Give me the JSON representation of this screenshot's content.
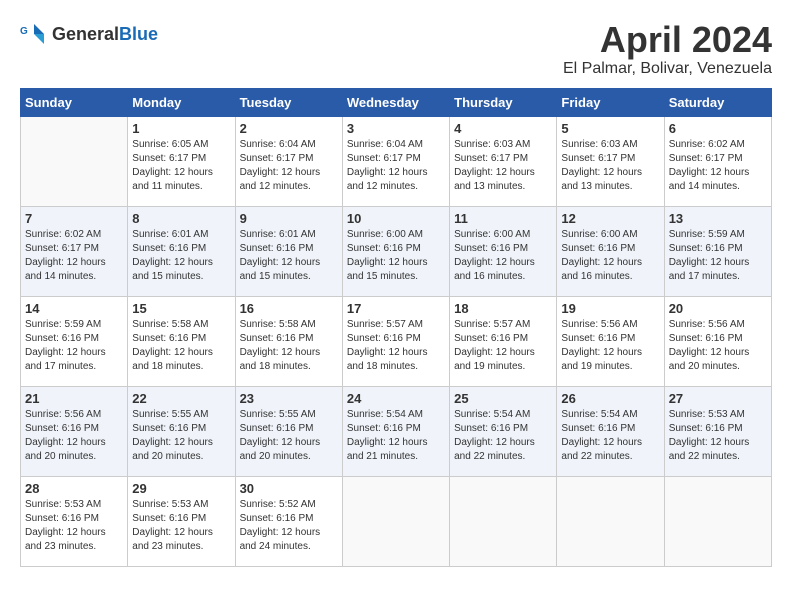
{
  "logo": {
    "general": "General",
    "blue": "Blue"
  },
  "title": "April 2024",
  "subtitle": "El Palmar, Bolivar, Venezuela",
  "headers": [
    "Sunday",
    "Monday",
    "Tuesday",
    "Wednesday",
    "Thursday",
    "Friday",
    "Saturday"
  ],
  "weeks": [
    [
      {
        "day": "",
        "sunrise": "",
        "sunset": "",
        "daylight": ""
      },
      {
        "day": "1",
        "sunrise": "Sunrise: 6:05 AM",
        "sunset": "Sunset: 6:17 PM",
        "daylight": "Daylight: 12 hours and 11 minutes."
      },
      {
        "day": "2",
        "sunrise": "Sunrise: 6:04 AM",
        "sunset": "Sunset: 6:17 PM",
        "daylight": "Daylight: 12 hours and 12 minutes."
      },
      {
        "day": "3",
        "sunrise": "Sunrise: 6:04 AM",
        "sunset": "Sunset: 6:17 PM",
        "daylight": "Daylight: 12 hours and 12 minutes."
      },
      {
        "day": "4",
        "sunrise": "Sunrise: 6:03 AM",
        "sunset": "Sunset: 6:17 PM",
        "daylight": "Daylight: 12 hours and 13 minutes."
      },
      {
        "day": "5",
        "sunrise": "Sunrise: 6:03 AM",
        "sunset": "Sunset: 6:17 PM",
        "daylight": "Daylight: 12 hours and 13 minutes."
      },
      {
        "day": "6",
        "sunrise": "Sunrise: 6:02 AM",
        "sunset": "Sunset: 6:17 PM",
        "daylight": "Daylight: 12 hours and 14 minutes."
      }
    ],
    [
      {
        "day": "7",
        "sunrise": "Sunrise: 6:02 AM",
        "sunset": "Sunset: 6:17 PM",
        "daylight": "Daylight: 12 hours and 14 minutes."
      },
      {
        "day": "8",
        "sunrise": "Sunrise: 6:01 AM",
        "sunset": "Sunset: 6:16 PM",
        "daylight": "Daylight: 12 hours and 15 minutes."
      },
      {
        "day": "9",
        "sunrise": "Sunrise: 6:01 AM",
        "sunset": "Sunset: 6:16 PM",
        "daylight": "Daylight: 12 hours and 15 minutes."
      },
      {
        "day": "10",
        "sunrise": "Sunrise: 6:00 AM",
        "sunset": "Sunset: 6:16 PM",
        "daylight": "Daylight: 12 hours and 15 minutes."
      },
      {
        "day": "11",
        "sunrise": "Sunrise: 6:00 AM",
        "sunset": "Sunset: 6:16 PM",
        "daylight": "Daylight: 12 hours and 16 minutes."
      },
      {
        "day": "12",
        "sunrise": "Sunrise: 6:00 AM",
        "sunset": "Sunset: 6:16 PM",
        "daylight": "Daylight: 12 hours and 16 minutes."
      },
      {
        "day": "13",
        "sunrise": "Sunrise: 5:59 AM",
        "sunset": "Sunset: 6:16 PM",
        "daylight": "Daylight: 12 hours and 17 minutes."
      }
    ],
    [
      {
        "day": "14",
        "sunrise": "Sunrise: 5:59 AM",
        "sunset": "Sunset: 6:16 PM",
        "daylight": "Daylight: 12 hours and 17 minutes."
      },
      {
        "day": "15",
        "sunrise": "Sunrise: 5:58 AM",
        "sunset": "Sunset: 6:16 PM",
        "daylight": "Daylight: 12 hours and 18 minutes."
      },
      {
        "day": "16",
        "sunrise": "Sunrise: 5:58 AM",
        "sunset": "Sunset: 6:16 PM",
        "daylight": "Daylight: 12 hours and 18 minutes."
      },
      {
        "day": "17",
        "sunrise": "Sunrise: 5:57 AM",
        "sunset": "Sunset: 6:16 PM",
        "daylight": "Daylight: 12 hours and 18 minutes."
      },
      {
        "day": "18",
        "sunrise": "Sunrise: 5:57 AM",
        "sunset": "Sunset: 6:16 PM",
        "daylight": "Daylight: 12 hours and 19 minutes."
      },
      {
        "day": "19",
        "sunrise": "Sunrise: 5:56 AM",
        "sunset": "Sunset: 6:16 PM",
        "daylight": "Daylight: 12 hours and 19 minutes."
      },
      {
        "day": "20",
        "sunrise": "Sunrise: 5:56 AM",
        "sunset": "Sunset: 6:16 PM",
        "daylight": "Daylight: 12 hours and 20 minutes."
      }
    ],
    [
      {
        "day": "21",
        "sunrise": "Sunrise: 5:56 AM",
        "sunset": "Sunset: 6:16 PM",
        "daylight": "Daylight: 12 hours and 20 minutes."
      },
      {
        "day": "22",
        "sunrise": "Sunrise: 5:55 AM",
        "sunset": "Sunset: 6:16 PM",
        "daylight": "Daylight: 12 hours and 20 minutes."
      },
      {
        "day": "23",
        "sunrise": "Sunrise: 5:55 AM",
        "sunset": "Sunset: 6:16 PM",
        "daylight": "Daylight: 12 hours and 20 minutes."
      },
      {
        "day": "24",
        "sunrise": "Sunrise: 5:54 AM",
        "sunset": "Sunset: 6:16 PM",
        "daylight": "Daylight: 12 hours and 21 minutes."
      },
      {
        "day": "25",
        "sunrise": "Sunrise: 5:54 AM",
        "sunset": "Sunset: 6:16 PM",
        "daylight": "Daylight: 12 hours and 22 minutes."
      },
      {
        "day": "26",
        "sunrise": "Sunrise: 5:54 AM",
        "sunset": "Sunset: 6:16 PM",
        "daylight": "Daylight: 12 hours and 22 minutes."
      },
      {
        "day": "27",
        "sunrise": "Sunrise: 5:53 AM",
        "sunset": "Sunset: 6:16 PM",
        "daylight": "Daylight: 12 hours and 22 minutes."
      }
    ],
    [
      {
        "day": "28",
        "sunrise": "Sunrise: 5:53 AM",
        "sunset": "Sunset: 6:16 PM",
        "daylight": "Daylight: 12 hours and 23 minutes."
      },
      {
        "day": "29",
        "sunrise": "Sunrise: 5:53 AM",
        "sunset": "Sunset: 6:16 PM",
        "daylight": "Daylight: 12 hours and 23 minutes."
      },
      {
        "day": "30",
        "sunrise": "Sunrise: 5:52 AM",
        "sunset": "Sunset: 6:16 PM",
        "daylight": "Daylight: 12 hours and 24 minutes."
      },
      {
        "day": "",
        "sunrise": "",
        "sunset": "",
        "daylight": ""
      },
      {
        "day": "",
        "sunrise": "",
        "sunset": "",
        "daylight": ""
      },
      {
        "day": "",
        "sunrise": "",
        "sunset": "",
        "daylight": ""
      },
      {
        "day": "",
        "sunrise": "",
        "sunset": "",
        "daylight": ""
      }
    ]
  ]
}
